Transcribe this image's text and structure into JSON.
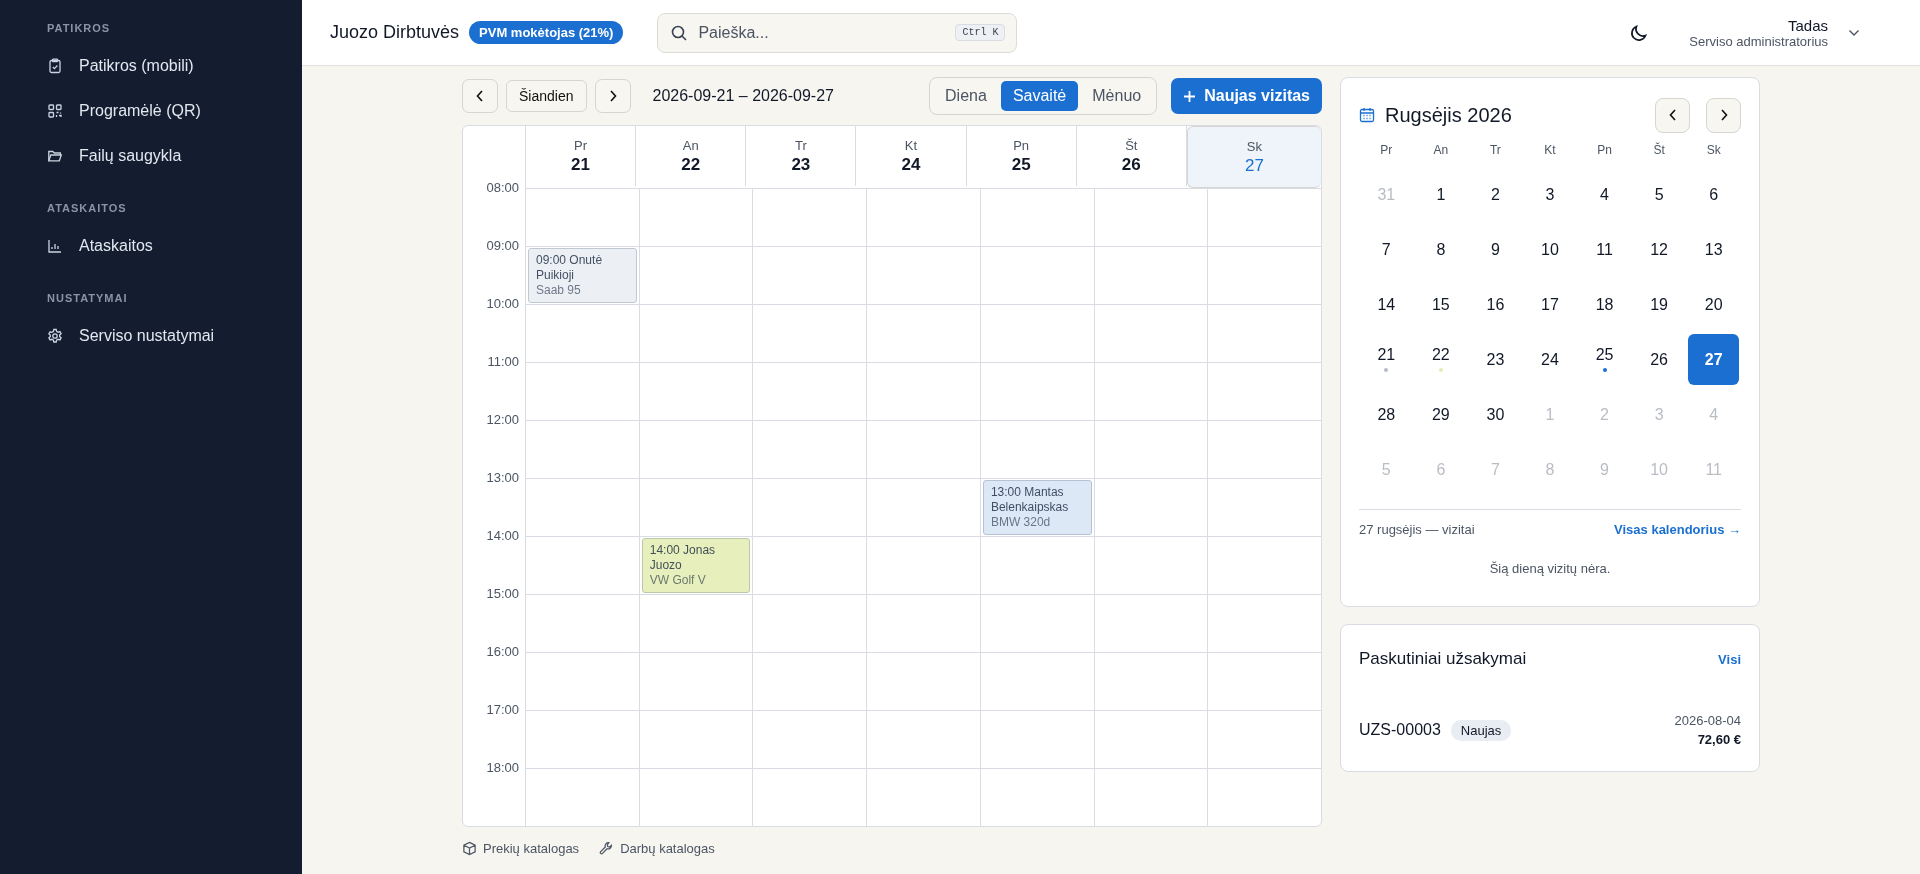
{
  "sidebar": {
    "sections": [
      {
        "heading": "PATIKROS",
        "items": [
          {
            "label": "Patikros (mobili)"
          },
          {
            "label": "Programėlė (QR)"
          },
          {
            "label": "Failų saugykla"
          }
        ]
      },
      {
        "heading": "ATASKAITOS",
        "items": [
          {
            "label": "Ataskaitos"
          }
        ]
      },
      {
        "heading": "NUSTATYMAI",
        "items": [
          {
            "label": "Serviso nustatymai"
          }
        ]
      }
    ]
  },
  "header": {
    "company": "Juozo Dirbtuvės",
    "badge": "PVM mokėtojas (21%)",
    "search": {
      "placeholder": "Paieška...",
      "shortcut": "Ctrl K"
    },
    "user": {
      "name": "Tadas",
      "role": "Serviso administratorius"
    }
  },
  "toolbar": {
    "today": "Šiandien",
    "range": "2026-09-21 – 2026-09-27",
    "views": [
      {
        "label": "Diena",
        "selected": false
      },
      {
        "label": "Savaitė",
        "selected": true
      },
      {
        "label": "Mėnuo",
        "selected": false
      }
    ],
    "new_button": "Naujas vizitas"
  },
  "week": {
    "days": [
      {
        "name": "Pr",
        "date": "21",
        "today": false
      },
      {
        "name": "An",
        "date": "22",
        "today": false
      },
      {
        "name": "Tr",
        "date": "23",
        "today": false
      },
      {
        "name": "Kt",
        "date": "24",
        "today": false
      },
      {
        "name": "Pn",
        "date": "25",
        "today": false
      },
      {
        "name": "Št",
        "date": "26",
        "today": false
      },
      {
        "name": "Sk",
        "date": "27",
        "today": true
      }
    ],
    "rows": [
      {
        "time": "08:00",
        "cells": [
          {},
          {},
          {},
          {},
          {},
          {},
          {}
        ]
      },
      {
        "time": "09:00",
        "cells": [
          {
            "title": "09:00 Onutė Puikioji",
            "vehicle": "Saab 95",
            "color": "#ecf0f5"
          },
          {},
          {},
          {},
          {},
          {},
          {}
        ]
      },
      {
        "time": "10:00",
        "cells": [
          {},
          {},
          {},
          {},
          {},
          {},
          {}
        ]
      },
      {
        "time": "11:00",
        "cells": [
          {},
          {},
          {},
          {},
          {},
          {},
          {}
        ]
      },
      {
        "time": "12:00",
        "cells": [
          {},
          {},
          {},
          {},
          {},
          {},
          {}
        ]
      },
      {
        "time": "13:00",
        "cells": [
          {},
          {},
          {},
          {},
          {
            "title": "13:00 Mantas Belenkaipskas",
            "vehicle": "BMW 320d",
            "color": "#dde8f6"
          },
          {},
          {}
        ]
      },
      {
        "time": "14:00",
        "cells": [
          {},
          {
            "title": "14:00 Jonas Juozo",
            "vehicle": "VW Golf V",
            "color": "#e7f0bd"
          },
          {},
          {},
          {},
          {},
          {}
        ]
      },
      {
        "time": "15:00",
        "cells": [
          {},
          {},
          {},
          {},
          {},
          {},
          {}
        ]
      },
      {
        "time": "16:00",
        "cells": [
          {},
          {},
          {},
          {},
          {},
          {},
          {}
        ]
      },
      {
        "time": "17:00",
        "cells": [
          {},
          {},
          {},
          {},
          {},
          {},
          {}
        ]
      },
      {
        "time": "18:00",
        "cells": [
          {},
          {},
          {},
          {},
          {},
          {},
          {}
        ]
      }
    ]
  },
  "month": {
    "title": "Rugsėjis 2026",
    "weekdays": [
      "Pr",
      "An",
      "Tr",
      "Kt",
      "Pn",
      "Št",
      "Sk"
    ],
    "weeks": [
      [
        {
          "day": "31",
          "outside": true,
          "selected": false
        },
        {
          "day": "1",
          "outside": false,
          "selected": false
        },
        {
          "day": "2",
          "outside": false,
          "selected": false
        },
        {
          "day": "3",
          "outside": false,
          "selected": false
        },
        {
          "day": "4",
          "outside": false,
          "selected": false
        },
        {
          "day": "5",
          "outside": false,
          "selected": false
        },
        {
          "day": "6",
          "outside": false,
          "selected": false
        }
      ],
      [
        {
          "day": "7",
          "outside": false,
          "selected": false
        },
        {
          "day": "8",
          "outside": false,
          "selected": false
        },
        {
          "day": "9",
          "outside": false,
          "selected": false
        },
        {
          "day": "10",
          "outside": false,
          "selected": false
        },
        {
          "day": "11",
          "outside": false,
          "selected": false
        },
        {
          "day": "12",
          "outside": false,
          "selected": false
        },
        {
          "day": "13",
          "outside": false,
          "selected": false
        }
      ],
      [
        {
          "day": "14",
          "outside": false,
          "selected": false
        },
        {
          "day": "15",
          "outside": false,
          "selected": false
        },
        {
          "day": "16",
          "outside": false,
          "selected": false
        },
        {
          "day": "17",
          "outside": false,
          "selected": false
        },
        {
          "day": "18",
          "outside": false,
          "selected": false
        },
        {
          "day": "19",
          "outside": false,
          "selected": false
        },
        {
          "day": "20",
          "outside": false,
          "selected": false
        }
      ],
      [
        {
          "day": "21",
          "outside": false,
          "selected": false,
          "color": "#b4bccc"
        },
        {
          "day": "22",
          "outside": false,
          "selected": false,
          "color": "#e4edb6"
        },
        {
          "day": "23",
          "outside": false,
          "selected": false
        },
        {
          "day": "24",
          "outside": false,
          "selected": false
        },
        {
          "day": "25",
          "outside": false,
          "selected": false,
          "color": "#1a6fd1"
        },
        {
          "day": "26",
          "outside": false,
          "selected": false
        },
        {
          "day": "27",
          "outside": false,
          "selected": true
        }
      ],
      [
        {
          "day": "28",
          "outside": false,
          "selected": false
        },
        {
          "day": "29",
          "outside": false,
          "selected": false
        },
        {
          "day": "30",
          "outside": false,
          "selected": false
        },
        {
          "day": "1",
          "outside": true,
          "selected": false
        },
        {
          "day": "2",
          "outside": true,
          "selected": false
        },
        {
          "day": "3",
          "outside": true,
          "selected": false
        },
        {
          "day": "4",
          "outside": true,
          "selected": false
        }
      ],
      [
        {
          "day": "5",
          "outside": true,
          "selected": false
        },
        {
          "day": "6",
          "outside": true,
          "selected": false
        },
        {
          "day": "7",
          "outside": true,
          "selected": false
        },
        {
          "day": "8",
          "outside": true,
          "selected": false
        },
        {
          "day": "9",
          "outside": true,
          "selected": false
        },
        {
          "day": "10",
          "outside": true,
          "selected": false
        },
        {
          "day": "11",
          "outside": true,
          "selected": false
        }
      ]
    ],
    "day_heading": "27 rugsėjis — vizitai",
    "all_link": "Visas kalendorius →",
    "empty": "Šią dieną vizitų nėra."
  },
  "orders": {
    "title": "Paskutiniai užsakymai",
    "all_link": "Visi",
    "items": [
      {
        "number": "UZS-00003",
        "status": "Naujas",
        "date": "2026-08-04",
        "amount": "72,60 €"
      }
    ]
  },
  "footer": [
    {
      "label": "Prekių katalogas"
    },
    {
      "label": "Darbų katalogas"
    }
  ]
}
